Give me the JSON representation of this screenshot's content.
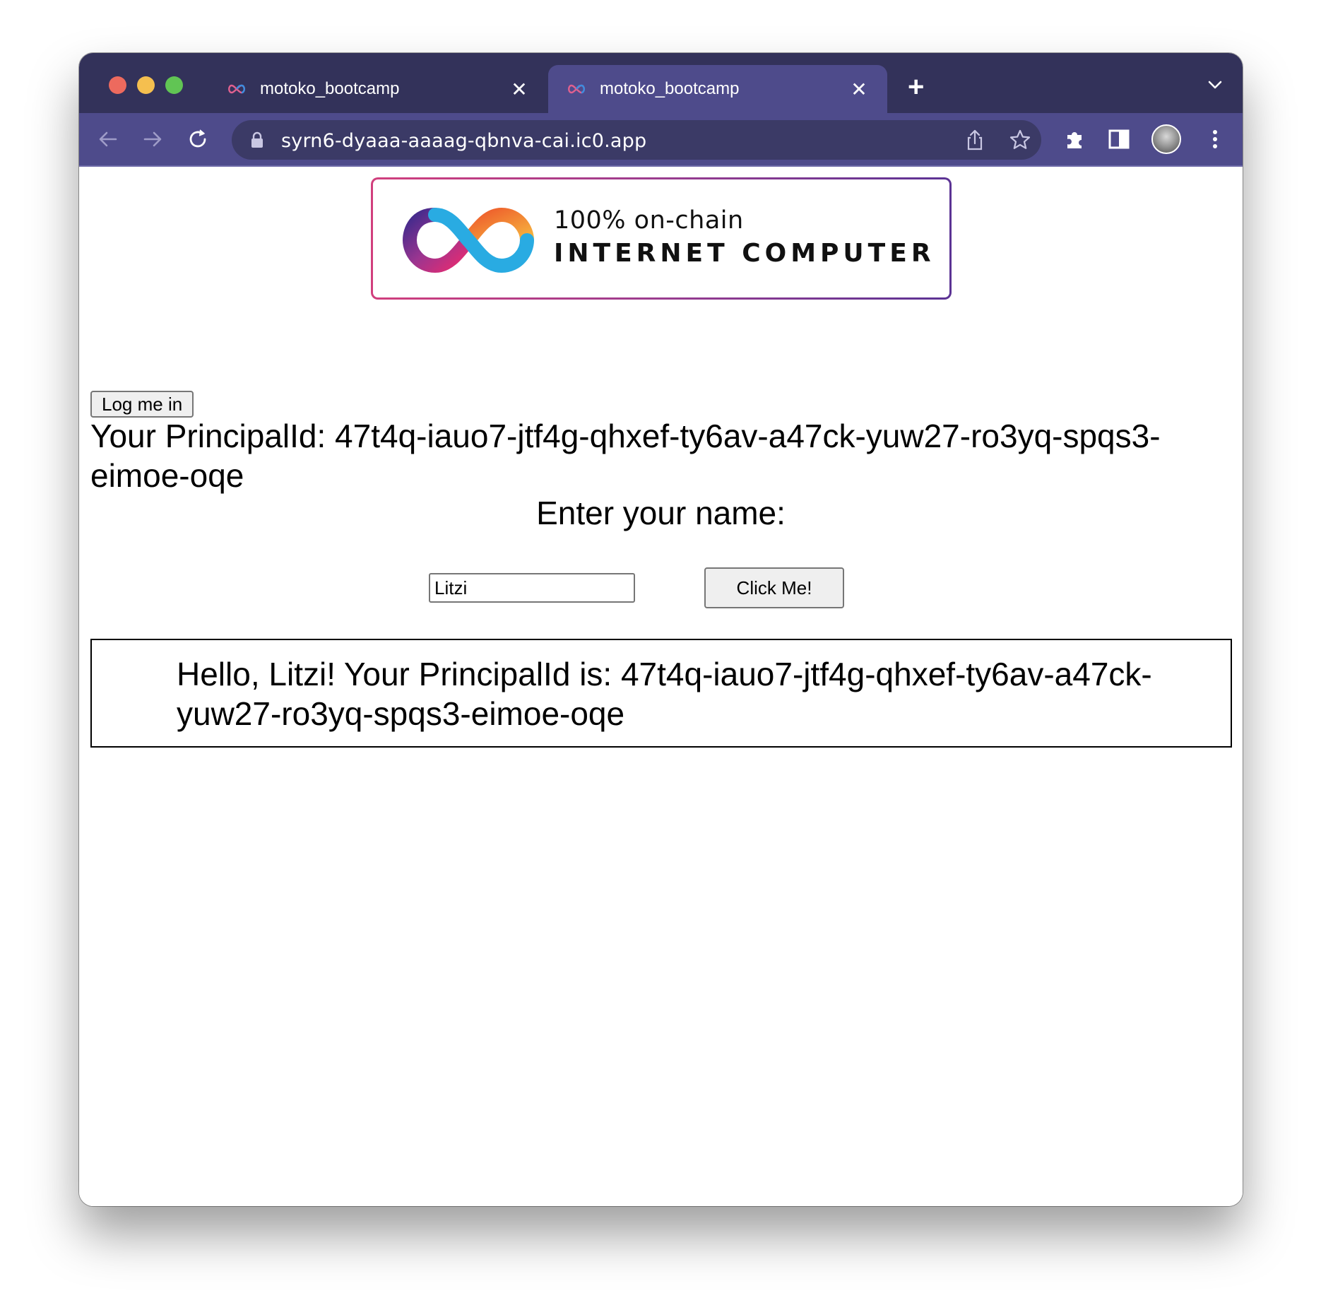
{
  "browser": {
    "tabs": [
      {
        "title": "motoko_bootcamp",
        "active": false
      },
      {
        "title": "motoko_bootcamp",
        "active": true
      }
    ],
    "new_tab_label": "+",
    "close_label": "✕",
    "url": "syrn6-dyaaa-aaaag-qbnva-cai.ic0.app",
    "colors": {
      "tabbar": "#33325a",
      "toolbar": "#4e4b8b",
      "close_dot": "#ed6a5e",
      "minimize_dot": "#f5bf4f",
      "zoom_dot": "#61c554"
    }
  },
  "banner": {
    "tagline": "100% on-chain",
    "brand": "INTERNET COMPUTER"
  },
  "page": {
    "login_button": "Log me in",
    "principal_text": "Your PrincipalId: 47t4q-iauo7-jtf4g-qhxef-ty6av-a47ck-yuw27-ro3yq-spqs3-eimoe-oqe",
    "enter_label": "Enter your name:",
    "name_value": "Litzi",
    "submit_button": "Click Me!",
    "greeting": "Hello, Litzi! Your PrincipalId is: 47t4q-iauo7-jtf4g-qhxef-ty6av-a47ck-yuw27-ro3yq-spqs3-eimoe-oqe"
  }
}
